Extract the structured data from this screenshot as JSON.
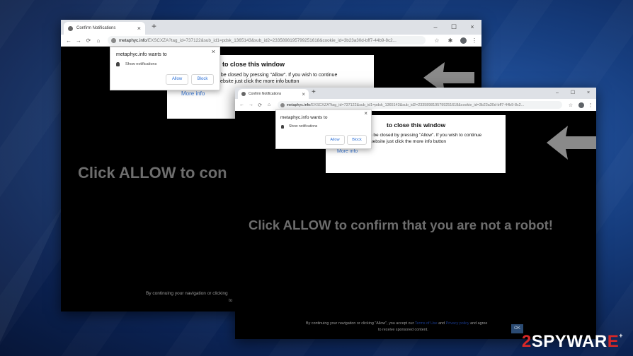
{
  "windows": [
    {
      "tab_title": "Confirm Notifications",
      "close_tab": "×",
      "new_tab": "+",
      "controls": [
        "–",
        "☐",
        "×"
      ],
      "url_host": "metaphyc.info",
      "url_rest": "/EXSCXZA?tag_id=737122&sub_id1=pdsk_1365143&sub_id2=2335898195799251618&cookie_id=3b23a30d-bff7-44b9-8c2...",
      "nav": [
        "←",
        "→",
        "⟳",
        "⌂"
      ],
      "toolbar_icons": [
        "☆",
        "✱",
        "⋮"
      ],
      "box_heading": "to close this window",
      "box_line1": "n be closed by pressing \"Allow\". If you wish to continue",
      "box_line2": "website just click the more info button",
      "more_info": "More info",
      "big_text": "Click ALLOW to con",
      "foot_line1": "By continuing your navigation or clicking",
      "foot_line2": "to",
      "popup": {
        "title": "metaphyc.info wants to",
        "perm": "Show notifications",
        "allow": "Allow",
        "block": "Block",
        "close": "×"
      }
    },
    {
      "tab_title": "Confirm Notifications",
      "close_tab": "×",
      "new_tab": "+",
      "controls": [
        "–",
        "☐",
        "×"
      ],
      "url_host": "metaphyc.info",
      "url_rest": "/EXSCXZA?tag_id=737122&sub_id1=pdsk_1365143&sub_id2=2335898195799251618&cookie_id=3b23a30d-bff7-44b9-8c2...",
      "nav": [
        "←",
        "→",
        "⟳",
        "⌂"
      ],
      "toolbar_icons": [
        "☆",
        "⋮"
      ],
      "box_heading": "to close this window",
      "box_line1": "n be closed by pressing \"Allow\". If you wish to continue",
      "box_line2": "website just click the more info button",
      "more_info": "More info",
      "big_text": "Click ALLOW to confirm that you are not a robot!",
      "foot_line1_a": "By continuing your navigation or clicking \"Allow\", you accept our",
      "foot_link1": "Terms of Use",
      "foot_and": "and",
      "foot_link2": "Privacy policy",
      "foot_line1_b": "and agree",
      "foot_line2": "to receive sponsored content.",
      "ok": "OK",
      "popup": {
        "title": "metaphyc.info wants to",
        "perm": "Show notifications",
        "allow": "Allow",
        "block": "Block",
        "close": "×"
      }
    }
  ],
  "watermark": {
    "part1": "2",
    "part2": "SPYWAR",
    "part3": "E",
    "sup": "+"
  },
  "colors": {
    "accent_link": "#3b7ad8",
    "arrow": "#8a8a8a",
    "watermark_red": "#d62828"
  }
}
